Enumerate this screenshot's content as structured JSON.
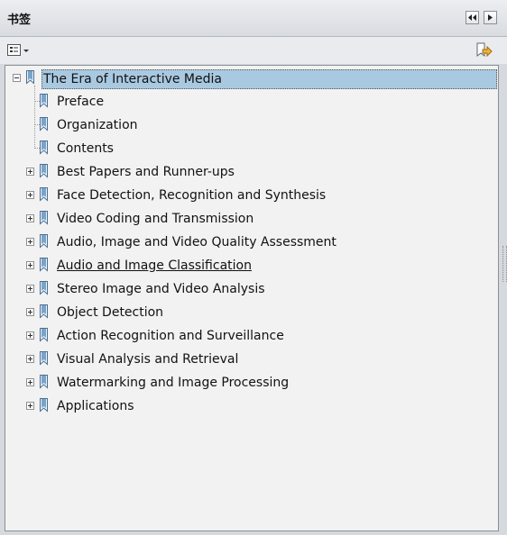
{
  "header": {
    "title": "书签"
  },
  "tree": {
    "root": {
      "label": "The Era of Interactive Media",
      "expanded": true,
      "selected": true
    },
    "items": [
      {
        "label": "Preface",
        "has_children": false
      },
      {
        "label": "Organization",
        "has_children": false
      },
      {
        "label": "Contents",
        "has_children": false
      },
      {
        "label": "Best Papers and Runner-ups",
        "has_children": true
      },
      {
        "label": "Face Detection, Recognition and Synthesis",
        "has_children": true
      },
      {
        "label": "Video Coding and Transmission",
        "has_children": true
      },
      {
        "label": "Audio, Image and Video Quality Assessment",
        "has_children": true
      },
      {
        "label": "Audio and Image Classification",
        "has_children": true,
        "hovered": true
      },
      {
        "label": "Stereo Image and Video Analysis",
        "has_children": true
      },
      {
        "label": "Object Detection",
        "has_children": true
      },
      {
        "label": "Action Recognition and Surveillance",
        "has_children": true
      },
      {
        "label": "Visual Analysis and Retrieval",
        "has_children": true
      },
      {
        "label": "Watermarking and Image Processing",
        "has_children": true
      },
      {
        "label": "Applications",
        "has_children": true
      }
    ]
  },
  "icons": {
    "collapse_panel": "double-left-arrow-icon",
    "close_panel": "right-arrow-icon",
    "options": "options-menu-icon",
    "expand_bookmark": "expand-bookmark-icon",
    "bookmark": "bookmark-icon"
  },
  "colors": {
    "selection": "#a9c9e1",
    "bookmark_icon": "#7aa3c9",
    "panel_bg": "#f2f2f2"
  }
}
